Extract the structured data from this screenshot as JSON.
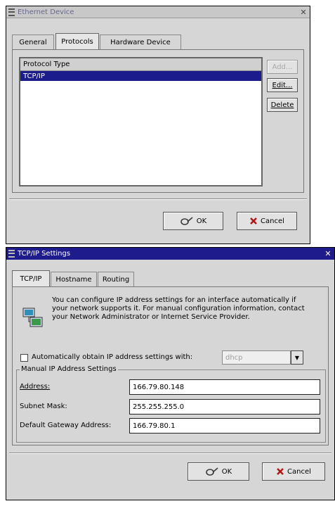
{
  "window1": {
    "title": "Ethernet Device",
    "tabs": [
      "General",
      "Protocols",
      "Hardware Device"
    ],
    "list": {
      "header": "Protocol Type",
      "rows": [
        "TCP/IP"
      ]
    },
    "buttons": {
      "add": "Add...",
      "edit": "Edit...",
      "delete": "Delete",
      "ok": "OK",
      "cancel": "Cancel"
    }
  },
  "window2": {
    "title": "TCP/IP Settings",
    "tabs": [
      "TCP/IP",
      "Hostname",
      "Routing"
    ],
    "info_text": "You can configure IP address settings for an interface automatically if your network supports it. For manual configuration information, contact your Network Administrator or Internet Service Provider.",
    "auto": {
      "label": "Automatically obtain IP address settings with:",
      "select_value": "dhcp"
    },
    "manual": {
      "group_title": "Manual IP Address Settings",
      "address_label": "Address:",
      "address_value": "166.79.80.148",
      "subnet_label": "Subnet Mask:",
      "subnet_value": "255.255.255.0",
      "gateway_label": "Default Gateway Address:",
      "gateway_value": "166.79.80.1"
    },
    "buttons": {
      "ok": "OK",
      "cancel": "Cancel"
    }
  }
}
